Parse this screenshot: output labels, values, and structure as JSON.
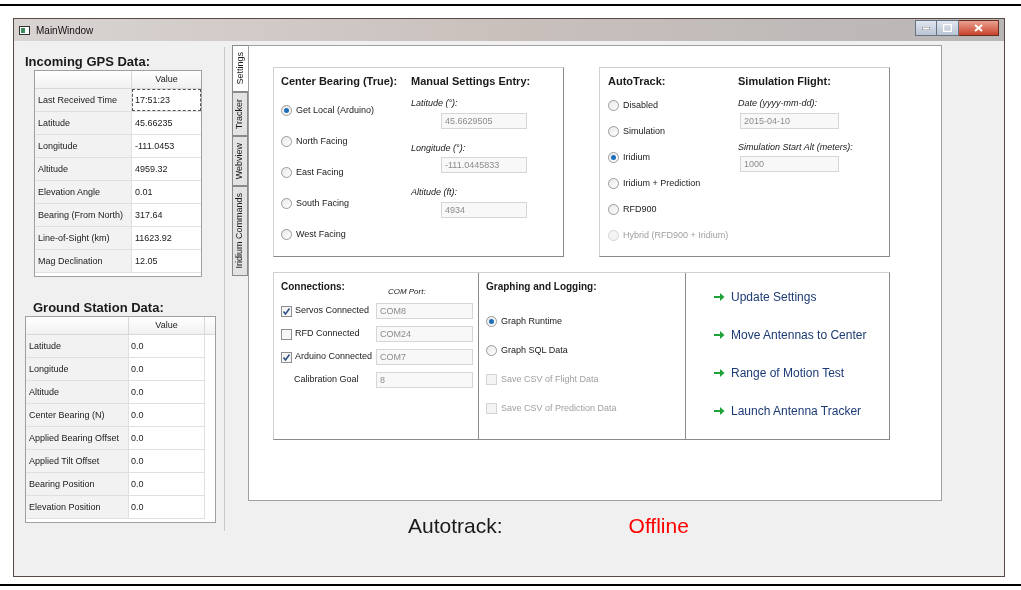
{
  "window": {
    "title": "MainWindow"
  },
  "gps_data": {
    "title": "Incoming GPS Data:",
    "value_header": "Value",
    "rows": [
      {
        "label": "Last Received Time",
        "value": "17:51:23",
        "focused": true
      },
      {
        "label": "Latitude",
        "value": "45.66235",
        "focused": false
      },
      {
        "label": "Longitude",
        "value": "-111.0453",
        "focused": false
      },
      {
        "label": "Altitude",
        "value": "4959.32",
        "focused": false
      },
      {
        "label": "Elevation Angle",
        "value": "0.01",
        "focused": false
      },
      {
        "label": "Bearing (From North)",
        "value": "317.64",
        "focused": false
      },
      {
        "label": "Line-of-Sight (km)",
        "value": "11623.92",
        "focused": false
      },
      {
        "label": "Mag Declination",
        "value": "12.05",
        "focused": false
      }
    ]
  },
  "ground_station": {
    "title": "Ground Station Data:",
    "value_header": "Value",
    "rows": [
      {
        "label": "Latitude",
        "value": "0.0"
      },
      {
        "label": "Longitude",
        "value": "0.0"
      },
      {
        "label": "Altitude",
        "value": "0.0"
      },
      {
        "label": "Center Bearing (N)",
        "value": "0.0"
      },
      {
        "label": "Applied Bearing Offset",
        "value": "0.0"
      },
      {
        "label": "Applied Tilt Offset",
        "value": "0.0"
      },
      {
        "label": "Bearing Position",
        "value": "0.0"
      },
      {
        "label": "Elevation Position",
        "value": "0.0"
      }
    ]
  },
  "tabs": [
    {
      "label": "Settings",
      "selected": true
    },
    {
      "label": "Tracker",
      "selected": false
    },
    {
      "label": "Webview",
      "selected": false
    },
    {
      "label": "Iridium Commands",
      "selected": false
    }
  ],
  "center_bearing": {
    "title": "Center Bearing (True):",
    "options": [
      {
        "label": "Get Local (Arduino)",
        "selected": true
      },
      {
        "label": "North Facing",
        "selected": false
      },
      {
        "label": "East Facing",
        "selected": false
      },
      {
        "label": "South Facing",
        "selected": false
      },
      {
        "label": "West Facing",
        "selected": false
      }
    ]
  },
  "manual_entry": {
    "title": "Manual Settings Entry:",
    "fields": [
      {
        "label": "Latitude (°):",
        "value": "45.6629505"
      },
      {
        "label": "Longitude (°):",
        "value": "-111.0445833"
      },
      {
        "label": "Altitude (ft):",
        "value": "4934"
      }
    ]
  },
  "autotrack": {
    "title": "AutoTrack:",
    "options": [
      {
        "label": "Disabled",
        "selected": false,
        "disabled": false
      },
      {
        "label": "Simulation",
        "selected": false,
        "disabled": false
      },
      {
        "label": "Iridium",
        "selected": true,
        "disabled": false
      },
      {
        "label": "Iridium + Prediction",
        "selected": false,
        "disabled": false
      },
      {
        "label": "RFD900",
        "selected": false,
        "disabled": false
      },
      {
        "label": "Hybrid (RFD900 + Iridium)",
        "selected": false,
        "disabled": true
      }
    ]
  },
  "simulation_flight": {
    "title": "Simulation Flight:",
    "fields": [
      {
        "label": "Date (yyyy-mm-dd):",
        "value": "2015-04-10"
      },
      {
        "label": "Simulation Start Alt (meters):",
        "value": "1000"
      }
    ]
  },
  "connections": {
    "title": "Connections:",
    "column_label": "COM Port:",
    "rows": [
      {
        "kind": "checkbox",
        "label": "Servos Connected",
        "checked": true,
        "value": "COM8"
      },
      {
        "kind": "checkbox",
        "label": "RFD Connected",
        "checked": false,
        "value": "COM24"
      },
      {
        "kind": "checkbox",
        "label": "Arduino Connected",
        "checked": true,
        "value": "COM7"
      },
      {
        "kind": "plain",
        "label": "Calibration Goal",
        "value": "8"
      }
    ]
  },
  "graphing": {
    "title": "Graphing and Logging:",
    "options": [
      {
        "kind": "radio",
        "label": "Graph Runtime",
        "selected": true,
        "disabled": false
      },
      {
        "kind": "radio",
        "label": "Graph SQL Data",
        "selected": false,
        "disabled": false
      },
      {
        "kind": "checkbox",
        "label": "Save CSV of Flight Data",
        "checked": false,
        "disabled": true
      },
      {
        "kind": "checkbox",
        "label": "Save CSV of Prediction Data",
        "checked": false,
        "disabled": true
      }
    ]
  },
  "actions": [
    "Update Settings",
    "Move Antennas to Center",
    "Range of Motion Test",
    "Launch Antenna Tracker"
  ],
  "status": {
    "label": "Autotrack:",
    "value": "Offline"
  }
}
